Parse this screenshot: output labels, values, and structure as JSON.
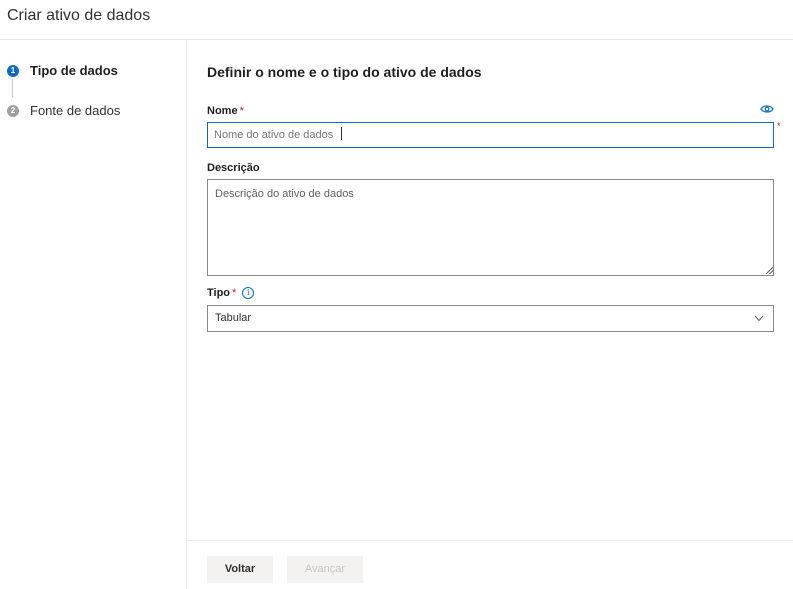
{
  "panel": {
    "title": "Criar ativo de dados"
  },
  "steps": [
    {
      "number": "1",
      "label": "Tipo de dados",
      "state": "active"
    },
    {
      "number": "2",
      "label": "Fonte de dados",
      "state": "inactive"
    }
  ],
  "form": {
    "heading": "Definir o nome e o tipo do ativo de dados",
    "name": {
      "label": "Nome",
      "required_mark": "*",
      "placeholder": "Nome do ativo de dados",
      "value": ""
    },
    "description": {
      "label": "Descrição",
      "placeholder": "Descrição do ativo de dados",
      "value": ""
    },
    "type": {
      "label": "Tipo",
      "required_mark": "*",
      "info_symbol": "i",
      "selected": "Tabular"
    },
    "outside_required_mark": "*"
  },
  "footer": {
    "back_label": "Voltar",
    "next_label": "Avançar"
  },
  "colors": {
    "accent": "#0f6cbd",
    "required": "#a4262c"
  }
}
